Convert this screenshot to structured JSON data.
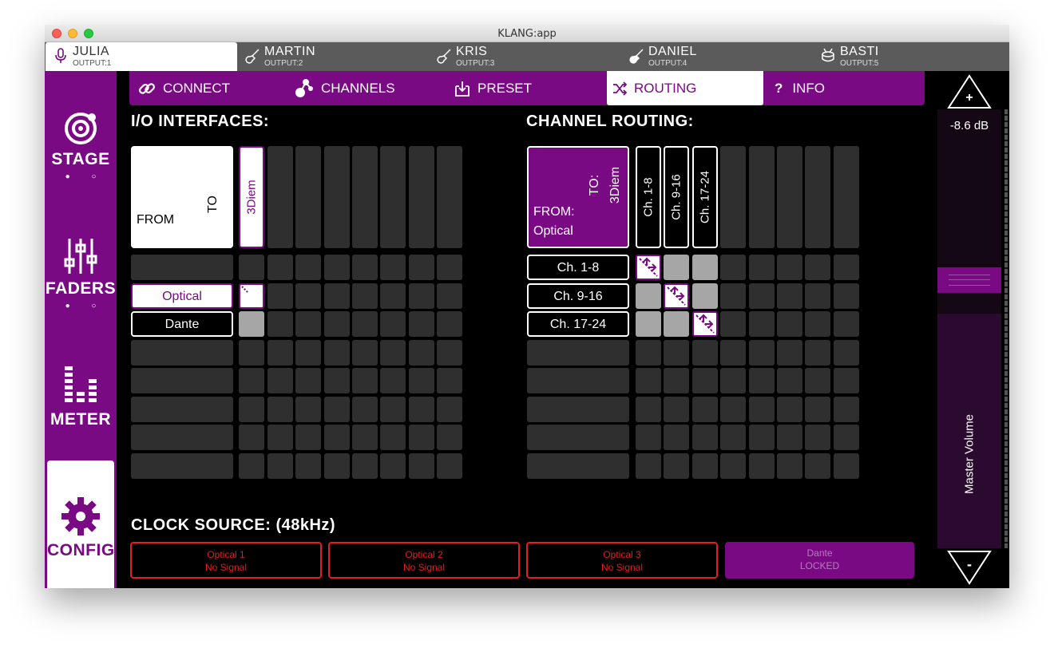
{
  "window": {
    "title": "KLANG:app"
  },
  "musicians": [
    {
      "name": "JULIA",
      "output": "OUTPUT:1",
      "icon": "microphone-icon",
      "active": true
    },
    {
      "name": "MARTIN",
      "output": "OUTPUT:2",
      "icon": "guitar-icon",
      "active": false
    },
    {
      "name": "KRIS",
      "output": "OUTPUT:3",
      "icon": "guitar-icon",
      "active": false
    },
    {
      "name": "DANIEL",
      "output": "OUTPUT:4",
      "icon": "guitar-icon",
      "active": false
    },
    {
      "name": "BASTI",
      "output": "OUTPUT:5",
      "icon": "drums-icon",
      "active": false
    }
  ],
  "sidebar": {
    "items": [
      {
        "label": "STAGE",
        "icon": "stage-icon",
        "dots": "● ○"
      },
      {
        "label": "FADERS",
        "icon": "faders-icon",
        "dots": "● ○"
      },
      {
        "label": "METER",
        "icon": "meter-icon"
      },
      {
        "label": "CONFIG",
        "icon": "gear-icon",
        "active": true
      }
    ]
  },
  "tabs": [
    {
      "label": "CONNECT",
      "icon": "link-icon"
    },
    {
      "label": "CHANNELS",
      "icon": "channels-icon"
    },
    {
      "label": "PRESET",
      "icon": "download-icon"
    },
    {
      "label": "ROUTING",
      "icon": "shuffle-icon",
      "active": true
    },
    {
      "label": "INFO",
      "icon": "question-icon",
      "prefix": "?"
    }
  ],
  "io": {
    "title": "I/O INTERFACES:",
    "corner_from": "FROM",
    "corner_to": "TO",
    "column": "3Diem",
    "rows": [
      "Optical",
      "Dante"
    ]
  },
  "routing": {
    "title": "CHANNEL ROUTING:",
    "corner_from": "FROM:",
    "corner_from_value": "Optical",
    "corner_to": "TO:",
    "corner_to_value": "3Diem",
    "columns": [
      "Ch. 1-8",
      "Ch. 9-16",
      "Ch. 17-24"
    ],
    "rows": [
      "Ch. 1-8",
      "Ch. 9-16",
      "Ch. 17-24"
    ]
  },
  "clock": {
    "title": "CLOCK SOURCE: (48kHz)",
    "sources": [
      {
        "name": "Optical 1",
        "status": "No Signal"
      },
      {
        "name": "Optical 2",
        "status": "No Signal"
      },
      {
        "name": "Optical 3",
        "status": "No Signal"
      },
      {
        "name": "Dante",
        "status": "LOCKED"
      }
    ]
  },
  "volume": {
    "value": "-8.6 dB",
    "label": "Master Volume",
    "plus": "+",
    "minus": "-"
  },
  "colors": {
    "accent": "#7a0a84",
    "error": "#e51c1c",
    "cell": "#2f2f2f"
  }
}
